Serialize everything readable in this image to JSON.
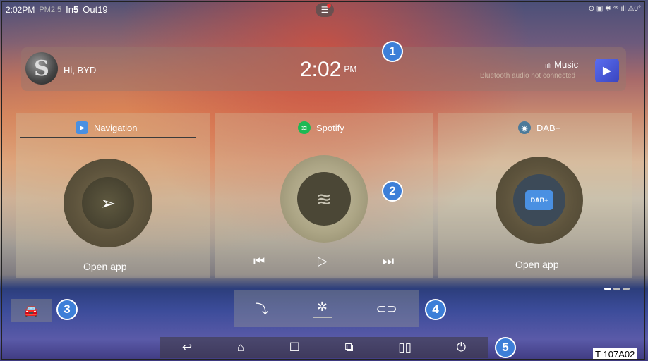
{
  "status": {
    "time": "2:02PM",
    "pm_label": "PM2.5",
    "in_label": "In",
    "in_value": "5",
    "out_label": "Out",
    "out_value": "19",
    "sys_icons": "⊙ ▣ ✱ ⁴⁶ ıll ⚠0°"
  },
  "header": {
    "greeting": "Hi, BYD",
    "clock": "2:02",
    "ampm": "PM",
    "music_title": "Music",
    "music_status": "Bluetooth audio not connected"
  },
  "cards": {
    "nav": {
      "tab_label": "Navigation",
      "action": "Open app"
    },
    "spotify": {
      "tab_label": "Spotify"
    },
    "dab": {
      "tab_label": "DAB+",
      "action": "Open app",
      "logo_text": "DAB+"
    }
  },
  "badges": {
    "b1": "1",
    "b2": "2",
    "b3": "3",
    "b4": "4",
    "b5": "5"
  },
  "figure_code": "T-107A02",
  "icons": {
    "notification": "notification-icon",
    "play": "play-icon",
    "car": "car-icon",
    "seat_airflow": "seat-airflow-icon",
    "fan": "fan-icon",
    "car_ac": "car-ac-icon",
    "back": "back-icon",
    "home": "home-icon",
    "recents": "recent-apps-icon",
    "screenshot": "screenshot-icon",
    "split": "split-screen-icon",
    "power": "power-icon"
  },
  "colors": {
    "badge": "#3d7fd8",
    "play_tile": "#4b5be0",
    "spotify": "#1db954"
  }
}
